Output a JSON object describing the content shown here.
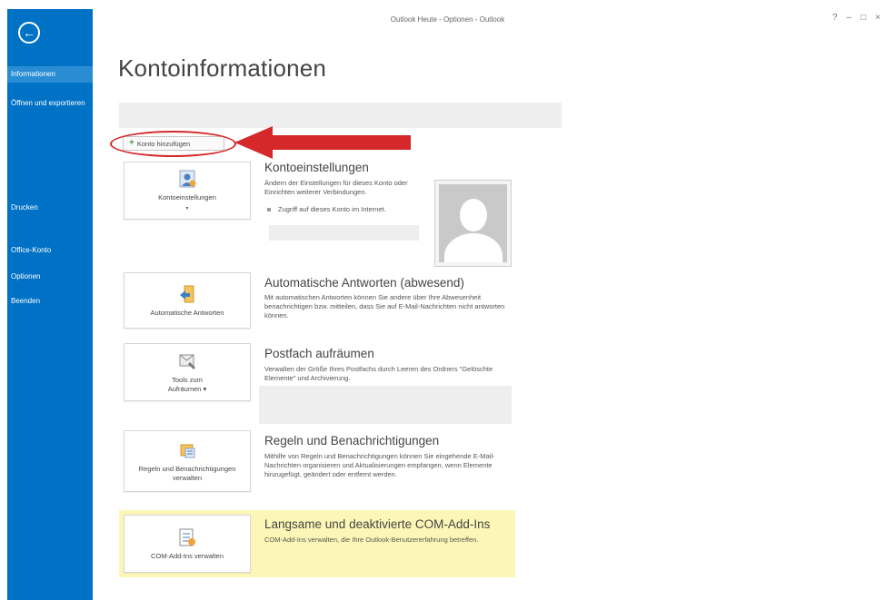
{
  "window": {
    "title": "Outlook Heute - Optionen - Outlook",
    "controls": [
      "?",
      "–",
      "□",
      "×"
    ]
  },
  "sidebar": {
    "back_icon": "back-arrow-icon",
    "items": [
      {
        "label": "Informationen",
        "active": true
      },
      {
        "label": "Öffnen und exportieren",
        "active": false
      },
      {
        "label": "Drucken",
        "active": false
      },
      {
        "label": "Office-Konto",
        "active": false
      },
      {
        "label": "Optionen",
        "active": false
      },
      {
        "label": "Beenden",
        "active": false
      }
    ]
  },
  "page": {
    "title": "Kontoinformationen",
    "add_account_label": "Konto hinzufügen"
  },
  "sections": [
    {
      "tile_label": "Kontoeinstellungen",
      "tile_caret": "▾",
      "heading": "Kontoeinstellungen",
      "description": "Ändern der Einstellungen für dieses Konto oder Einrichten weiterer Verbindungen.",
      "bullet": "Zugriff auf dieses Konto im Internet."
    },
    {
      "tile_label": "Automatische Antworten",
      "heading": "Automatische Antworten (abwesend)",
      "description": "Mit automatischen Antworten können Sie andere über Ihre Abwesenheit benachrichtigen bzw. mitteilen, dass Sie auf E-Mail-Nachrichten nicht antworten können."
    },
    {
      "tile_label": "Tools zum Aufräumen ▾",
      "heading": "Postfach aufräumen",
      "description": "Verwalten der Größe Ihres Postfachs durch Leeren des Ordners \"Gelöschte Elemente\" und Archivierung."
    },
    {
      "tile_label": "Regeln und Benachrichtigungen verwalten",
      "heading": "Regeln und Benachrichtigungen",
      "description": "Mithilfe von Regeln und Benachrichtigungen können Sie eingehende E-Mail-Nachrichten organisieren und Aktualisierungen empfangen, wenn Elemente hinzugefügt, geändert oder entfernt werden."
    },
    {
      "tile_label": "COM-Add-Ins verwalten",
      "heading": "Langsame und deaktivierte COM-Add-Ins",
      "description": "COM-Add-Ins verwalten, die Ihre Outlook-Benutzererfahrung betreffen."
    }
  ],
  "colors": {
    "sidebar": "#0072c6",
    "sidebar_active": "#2a8dd4",
    "highlight_red": "#d4282a",
    "com_addins_bg": "#fcf7b6"
  }
}
